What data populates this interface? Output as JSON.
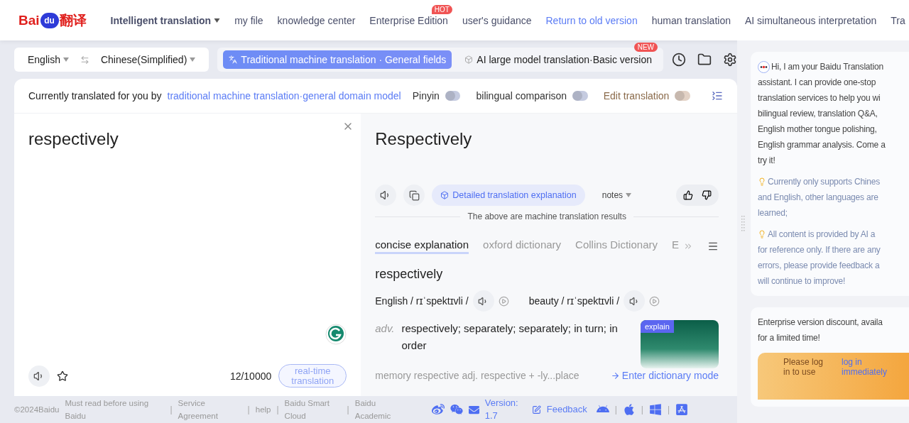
{
  "nav": {
    "logo": {
      "latin": "Bai",
      "badge": "du",
      "cn": "翻译"
    },
    "items": [
      {
        "label": "Intelligent translation",
        "kind": "dropdown"
      },
      {
        "label": "my file",
        "kind": "plain"
      },
      {
        "label": "knowledge center",
        "kind": "plain"
      },
      {
        "label": "Enterprise Edition",
        "kind": "plain",
        "badge": "HOT"
      },
      {
        "label": "user's guidance",
        "kind": "plain"
      },
      {
        "label": "Return to old version",
        "kind": "link"
      },
      {
        "label": "human translation",
        "kind": "plain"
      },
      {
        "label": "AI simultaneous interpretation",
        "kind": "plain"
      },
      {
        "label": "Tra",
        "kind": "plain"
      }
    ]
  },
  "languages": {
    "source": "English",
    "target": "Chinese(Simplified)"
  },
  "modes": [
    {
      "label": "Traditional machine translation · General fields",
      "selected": true
    },
    {
      "label": "AI large model translation·Basic version",
      "selected": false,
      "badge": "NEW"
    }
  ],
  "model_bar": {
    "prefix": "Currently translated for you by",
    "model": "traditional machine translation·general domain model",
    "toggles": [
      {
        "label": "Pinyin",
        "on": false,
        "color": "#c5cbe0"
      },
      {
        "label": "bilingual comparison",
        "on": false,
        "color": "#c5cbe0"
      },
      {
        "label": "Edit translation",
        "on": false,
        "color": "#e3d2c6"
      }
    ]
  },
  "source": {
    "text": "respectively",
    "count": "12/10000",
    "realtime": "real-time translation"
  },
  "result": {
    "text": "Respectively",
    "detail_button": "Detailed translation explanation",
    "notes": "notes",
    "notice": "The above are machine translation results"
  },
  "dictionary": {
    "tabs": [
      {
        "label": "concise explanation",
        "selected": true
      },
      {
        "label": "oxford dictionary",
        "selected": false
      },
      {
        "label": "Collins Dictionary",
        "selected": false
      },
      {
        "label": "E",
        "selected": false
      }
    ],
    "word": "respectively",
    "pronunciations": [
      {
        "label": "English / rɪˈspektɪvli /"
      },
      {
        "label": "beauty / rɪˈspektɪvli /"
      }
    ],
    "definitions": [
      {
        "pos": "adv.",
        "text": "respectively; separately; separately; in turn; in order"
      }
    ],
    "memory": "memory  respective adj. respective + -ly...place",
    "video_badge": "explain",
    "enter_link": "Enter dictionary mode"
  },
  "footer": {
    "copyright": "©2024Baidu",
    "links": [
      {
        "label": "Must read before using Baidu"
      },
      {
        "separator": "|",
        "label": "Service Agreement"
      },
      {
        "separator": "|",
        "label": "help"
      },
      {
        "separator": "|",
        "label": "Baidu Smart Cloud"
      },
      {
        "separator": "|",
        "label": "Baidu Academic"
      }
    ],
    "app_separators": [
      "|",
      "|",
      "|"
    ],
    "version": "Version: 1.7",
    "feedback": "Feedback"
  },
  "assistant": {
    "intro": [
      "Hi, I am your Baidu Translation",
      "assistant. I can provide one-stop",
      "translation services to help you wi",
      "bilingual review, translation Q&A,",
      "English mother tongue polishing,",
      "English grammar analysis. Come a",
      "try it!"
    ],
    "tips": [
      {
        "lines": [
          "Currently only supports Chines",
          "and English, other languages are",
          "learned;"
        ]
      },
      {
        "lines": [
          "All content is provided by AI a",
          "for reference only. If there are any",
          "errors, please provide feedback a",
          "will continue to improve!"
        ]
      }
    ]
  },
  "promo": {
    "lines": [
      "Enterprise version discount, availa",
      "for a limited time!"
    ],
    "login_prompt": "Please log in to use",
    "login_link": "log in immediately"
  }
}
